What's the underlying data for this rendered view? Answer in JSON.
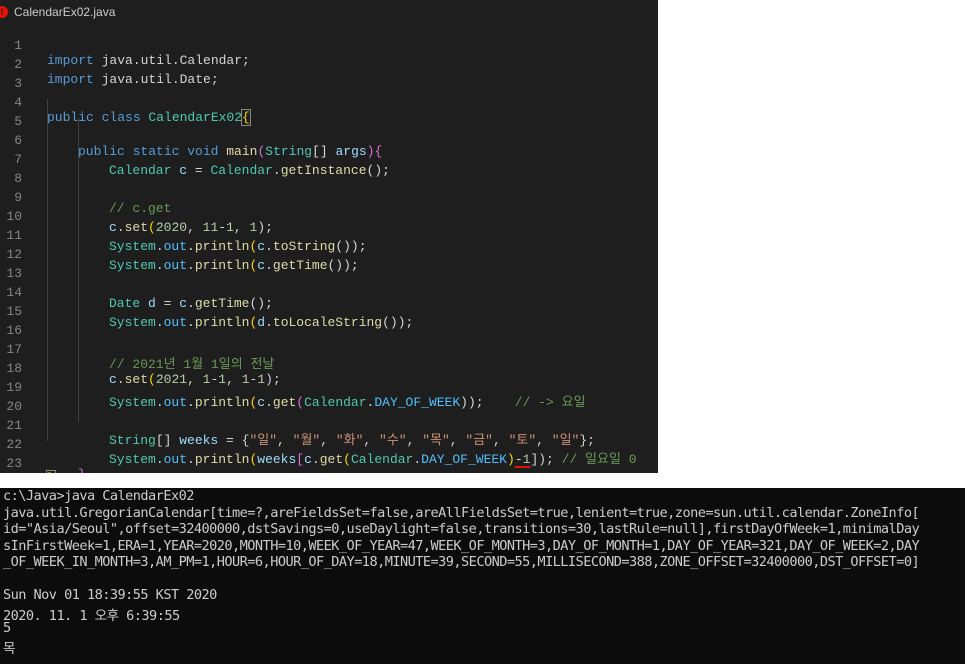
{
  "editor": {
    "tab": {
      "icon_text": "!",
      "filename": "CalendarEx02.java"
    },
    "line_numbers": [
      "1",
      "2",
      "3",
      "4",
      "5",
      "6",
      "7",
      "8",
      "9",
      "10",
      "11",
      "12",
      "13",
      "14",
      "15",
      "16",
      "17",
      "18",
      "19",
      "20",
      "21",
      "22",
      "23"
    ],
    "code": {
      "l1": {
        "kw": "import",
        "rest": " java.util.Calendar;"
      },
      "l2": {
        "kw": "import",
        "rest": " java.util.Date;"
      },
      "l4": {
        "kw1": "public",
        "kw2": " class ",
        "cls": "CalendarEx02",
        "brace": "{"
      },
      "l5": {
        "kw1": "public",
        "kw2": " static",
        "kw3": " void ",
        "fn": "main",
        "p1": "(",
        "ty": "String",
        "p2": "[] ",
        "va": "args",
        "p3": "){"
      },
      "l6": {
        "ty": "Calendar",
        "sp": " ",
        "va": "c",
        "eq": " = ",
        "cls": "Calendar",
        "dot": ".",
        "fn": "getInstance",
        "end": "();"
      },
      "l8": {
        "cm": "// c.get"
      },
      "l9": {
        "va": "c",
        "dot": ".",
        "fn": "set",
        "p1": "(",
        "n1": "2020",
        "c1": ", ",
        "n2": "11",
        "m": "-",
        "n3": "1",
        "c2": ", ",
        "n4": "1",
        "end": ");"
      },
      "l10": {
        "cls": "System",
        "d1": ".",
        "co": "out",
        "d2": ".",
        "fn": "println",
        "p1": "(",
        "va": "c",
        "d3": ".",
        "fn2": "toString",
        "end": "());"
      },
      "l11": {
        "cls": "System",
        "d1": ".",
        "co": "out",
        "d2": ".",
        "fn": "println",
        "p1": "(",
        "va": "c",
        "d3": ".",
        "fn2": "getTime",
        "end": "());"
      },
      "l13": {
        "ty": "Date",
        "sp": " ",
        "va": "d",
        "eq": " = ",
        "va2": "c",
        "dot": ".",
        "fn": "getTime",
        "end": "();"
      },
      "l14": {
        "cls": "System",
        "d1": ".",
        "co": "out",
        "d2": ".",
        "fn": "println",
        "p1": "(",
        "va": "d",
        "d3": ".",
        "fn2": "toLocaleString",
        "end": "());"
      },
      "l16": {
        "cm": "// 2021년 1월 1일의 전날"
      },
      "l17": {
        "va": "c",
        "dot": ".",
        "fn": "set",
        "p1": "(",
        "n1": "2021",
        "c1": ", ",
        "n2": "1",
        "m": "-",
        "n3": "1",
        "c2": ", ",
        "n4": "1",
        "m2": "-",
        "n5": "1",
        "end": ");"
      },
      "l18": {
        "cls": "System",
        "d1": ".",
        "co": "out",
        "d2": ".",
        "fn": "println",
        "p1": "(",
        "va": "c",
        "d3": ".",
        "fn2": "get",
        "p2": "(",
        "cls2": "Calendar",
        "d4": ".",
        "co2": "DAY_OF_WEEK",
        "end": "));",
        "sp": "    ",
        "cm": "// -> 요일"
      },
      "l20": {
        "ty": "String",
        "p1": "[] ",
        "va": "weeks",
        "eq": " = {",
        "days": [
          "\"일\"",
          "\"월\"",
          "\"화\"",
          "\"수\"",
          "\"목\"",
          "\"금\"",
          "\"토\"",
          "\"일\""
        ],
        "sep": ", ",
        "end": "};"
      },
      "l21": {
        "cls": "System",
        "d1": ".",
        "co": "out",
        "d2": ".",
        "fn": "println",
        "p1": "(",
        "va": "weeks",
        "p2": "[",
        "va2": "c",
        "d3": ".",
        "fn2": "get",
        "p3": "(",
        "cls2": "Calendar",
        "d4": ".",
        "co2": "DAY_OF_WEEK",
        "p4": ")",
        "m": "-",
        "n": "1",
        "end": "]);",
        "sp": " ",
        "cm": "// 일요일 0"
      },
      "l22": {
        "brace": "}"
      },
      "l23": {
        "brace": "}"
      }
    }
  },
  "console": {
    "lines": [
      "c:\\Java>java CalendarEx02",
      "java.util.GregorianCalendar[time=?,areFieldsSet=false,areAllFieldsSet=true,lenient=true,zone=sun.util.calendar.ZoneInfo[",
      "id=\"Asia/Seoul\",offset=32400000,dstSavings=0,useDaylight=false,transitions=30,lastRule=null],firstDayOfWeek=1,minimalDay",
      "sInFirstWeek=1,ERA=1,YEAR=2020,MONTH=10,WEEK_OF_YEAR=47,WEEK_OF_MONTH=3,DAY_OF_MONTH=1,DAY_OF_YEAR=321,DAY_OF_WEEK=2,DAY",
      "_OF_WEEK_IN_MONTH=3,AM_PM=1,HOUR=6,HOUR_OF_DAY=18,MINUTE=39,SECOND=55,MILLISECOND=388,ZONE_OFFSET=32400000,DST_OFFSET=0]",
      "",
      "Sun Nov 01 18:39:55 KST 2020",
      "2020. 11. 1 오후 6:39:55",
      "5",
      "목"
    ]
  }
}
